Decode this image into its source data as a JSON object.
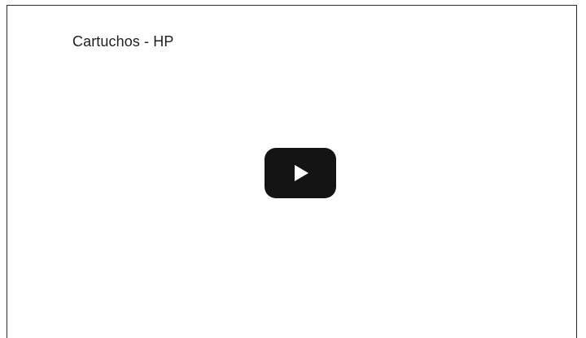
{
  "video": {
    "title": "Cartuchos - HP",
    "play_icon": "play-icon"
  },
  "colors": {
    "background": "#ffffff",
    "frame_border": "#2b2b2b",
    "title_text": "#1f1f1f",
    "play_button_bg": "#141414",
    "play_icon_fill": "#ffffff"
  }
}
